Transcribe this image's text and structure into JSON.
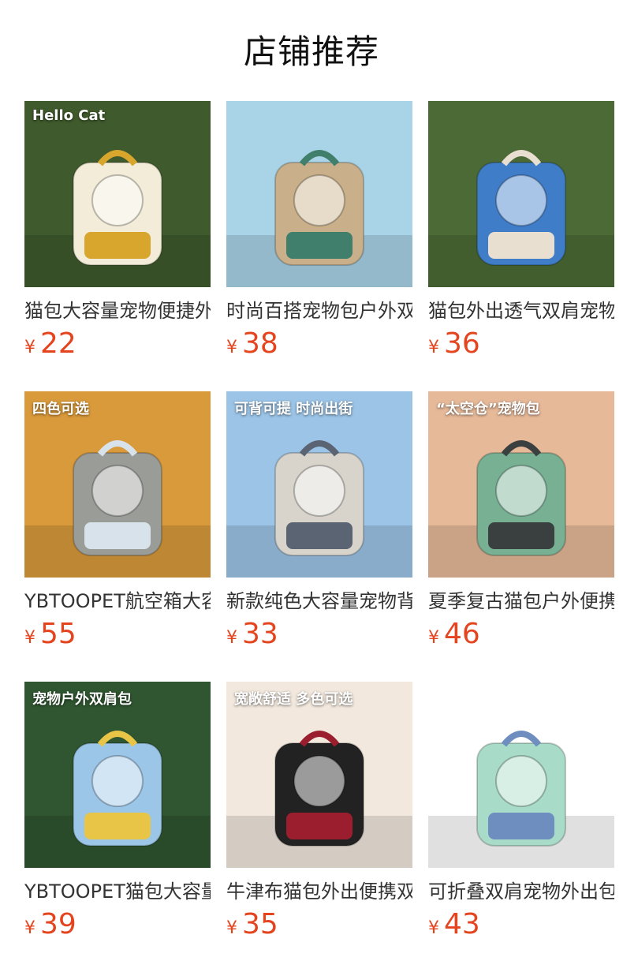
{
  "page": {
    "title": "店铺推荐"
  },
  "currency": "¥",
  "products": [
    {
      "title": "猫包大容量宠物便捷外出背包",
      "price": "22",
      "image": {
        "bg": "#3f5a2c",
        "bag": "#f2ecd8",
        "accent": "#d8a62c",
        "badge": "Hello Cat"
      }
    },
    {
      "title": "时尚百搭宠物包户外双肩包",
      "price": "38",
      "image": {
        "bg": "#a9d3e6",
        "bag": "#c9b08a",
        "accent": "#3f7f6c"
      }
    },
    {
      "title": "猫包外出透气双肩宠物背包",
      "price": "36",
      "image": {
        "bg": "#4c6a35",
        "bag": "#3f7dc9",
        "accent": "#e8dfd0"
      }
    },
    {
      "title": "YBTOOPET航空箱大容量猫包",
      "price": "55",
      "image": {
        "bg": "#d99a3b",
        "bag": "#9a9c98",
        "accent": "#d7e2ea",
        "badge": "四色可选"
      }
    },
    {
      "title": "新款纯色大容量宠物背包",
      "price": "33",
      "image": {
        "bg": "#9cc4e6",
        "bag": "#d8d4cc",
        "accent": "#5a6472",
        "badge": "可背可提 时尚出街"
      }
    },
    {
      "title": "夏季复古猫包户外便携背包",
      "price": "46",
      "image": {
        "bg": "#e6b999",
        "bag": "#78b094",
        "accent": "#3a4040",
        "badge": "“太空仓”宠物包"
      }
    },
    {
      "title": "YBTOOPET猫包大容量双肩包",
      "price": "39",
      "image": {
        "bg": "#2f5630",
        "bag": "#9cc6e8",
        "accent": "#e8c547",
        "badge": "宠物户外双肩包"
      }
    },
    {
      "title": "牛津布猫包外出便携双肩包",
      "price": "35",
      "image": {
        "bg": "#f2e8dd",
        "bag": "#222222",
        "accent": "#9a1e2e",
        "badge": "宽敞舒适 多色可选"
      }
    },
    {
      "title": "可折叠双肩宠物外出包",
      "price": "43",
      "image": {
        "bg": "#ffffff",
        "bag": "#a9dcc8",
        "accent": "#6f8ec0"
      }
    }
  ]
}
